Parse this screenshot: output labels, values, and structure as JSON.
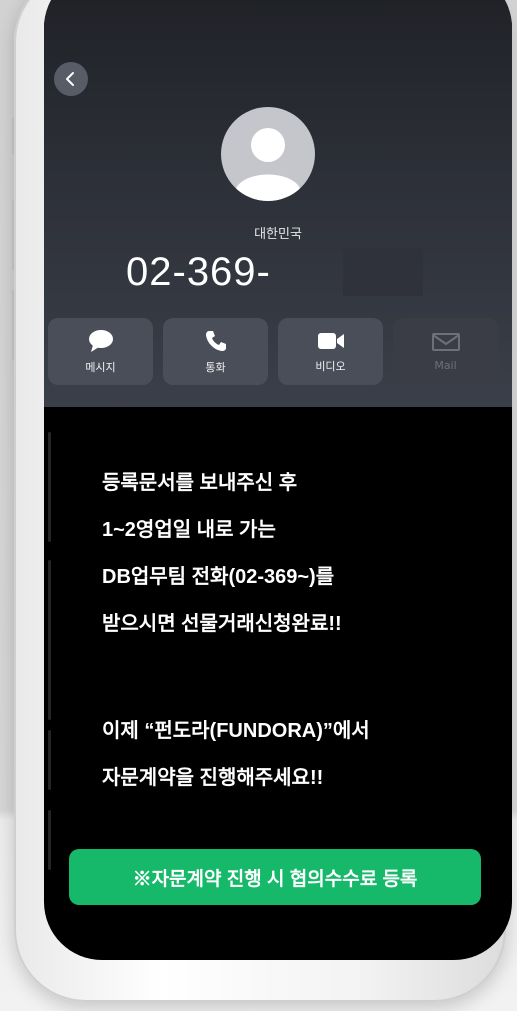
{
  "contact": {
    "country": "대한민국",
    "number": "02-369-"
  },
  "actions": [
    {
      "label": "메시지",
      "icon": "message-bubble-icon",
      "enabled": true
    },
    {
      "label": "통화",
      "icon": "phone-icon",
      "enabled": true
    },
    {
      "label": "비디오",
      "icon": "video-camera-icon",
      "enabled": true
    },
    {
      "label": "Mail",
      "icon": "mail-icon",
      "enabled": false
    }
  ],
  "message_lines": [
    "등록문서를 보내주신 후",
    "1~2영업일 내로 가는",
    "DB업무팀 전화(02-369~)를",
    "받으시면 선물거래신청완료!!",
    "이제 “펀도라(FUNDORA)”에서",
    "자문계약을 진행해주세요!!"
  ],
  "cta": {
    "label": "※자문계약 진행 시 협의수수료 등록"
  },
  "colors": {
    "cta_green": "#16b86a",
    "action_tile": "#4a4e58",
    "screen_top": "#2c2f37",
    "screen_bottom": "#000000"
  }
}
